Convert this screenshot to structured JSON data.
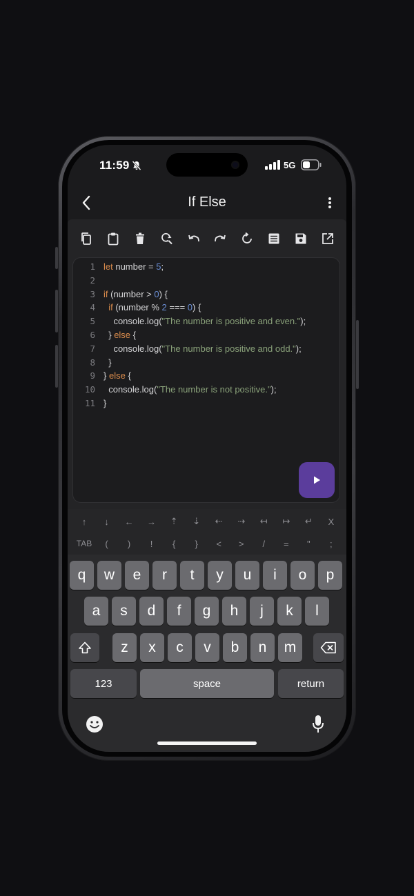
{
  "status_bar": {
    "time": "11:59",
    "network": "5G"
  },
  "header": {
    "title": "If Else"
  },
  "toolbar": {
    "icons": [
      "copy-icon",
      "paste-icon",
      "trash-icon",
      "find-replace-icon",
      "undo-icon",
      "redo-icon",
      "reload-icon",
      "format-icon",
      "save-icon",
      "share-icon"
    ]
  },
  "editor": {
    "lines": [
      {
        "n": "1",
        "tokens": [
          {
            "t": "let",
            "c": "kw"
          },
          {
            "t": " number = ",
            "c": "pl"
          },
          {
            "t": "5",
            "c": "num"
          },
          {
            "t": ";",
            "c": "pl"
          }
        ]
      },
      {
        "n": "2",
        "tokens": []
      },
      {
        "n": "3",
        "tokens": [
          {
            "t": "if",
            "c": "kw"
          },
          {
            "t": " (number > ",
            "c": "pl"
          },
          {
            "t": "0",
            "c": "num"
          },
          {
            "t": ") {",
            "c": "pl"
          }
        ]
      },
      {
        "n": "4",
        "tokens": [
          {
            "t": "  ",
            "c": "pl"
          },
          {
            "t": "if",
            "c": "kw"
          },
          {
            "t": " (number % ",
            "c": "pl"
          },
          {
            "t": "2",
            "c": "num"
          },
          {
            "t": " === ",
            "c": "pl"
          },
          {
            "t": "0",
            "c": "num"
          },
          {
            "t": ") {",
            "c": "pl"
          }
        ]
      },
      {
        "n": "5",
        "tokens": [
          {
            "t": "    console.log(",
            "c": "pl"
          },
          {
            "t": "\"The number is positive and even.\"",
            "c": "str"
          },
          {
            "t": ");",
            "c": "pl"
          }
        ]
      },
      {
        "n": "6",
        "tokens": [
          {
            "t": "  } ",
            "c": "pl"
          },
          {
            "t": "else",
            "c": "kw"
          },
          {
            "t": " {",
            "c": "pl"
          }
        ]
      },
      {
        "n": "7",
        "tokens": [
          {
            "t": "    console.log(",
            "c": "pl"
          },
          {
            "t": "\"The number is positive and odd.\"",
            "c": "str"
          },
          {
            "t": ");",
            "c": "pl"
          }
        ]
      },
      {
        "n": "8",
        "tokens": [
          {
            "t": "  }",
            "c": "pl"
          }
        ]
      },
      {
        "n": "9",
        "tokens": [
          {
            "t": "} ",
            "c": "pl"
          },
          {
            "t": "else",
            "c": "kw"
          },
          {
            "t": " {",
            "c": "pl"
          }
        ]
      },
      {
        "n": "10",
        "tokens": [
          {
            "t": "  console.log(",
            "c": "pl"
          },
          {
            "t": "\"The number is not positive.\"",
            "c": "str"
          },
          {
            "t": ");",
            "c": "pl"
          }
        ]
      },
      {
        "n": "11",
        "tokens": [
          {
            "t": "}",
            "c": "pl"
          }
        ]
      }
    ]
  },
  "accessory": {
    "row1": [
      "↑",
      "↓",
      "←",
      "→",
      "⇡",
      "⇣",
      "⇠",
      "⇢",
      "↤",
      "↦",
      "↵",
      "X"
    ],
    "row2": [
      "TAB",
      "(",
      ")",
      "!",
      "{",
      "}",
      "<",
      ">",
      "/",
      "=",
      "\"",
      ";"
    ]
  },
  "keyboard": {
    "row1": [
      "q",
      "w",
      "e",
      "r",
      "t",
      "y",
      "u",
      "i",
      "o",
      "p"
    ],
    "row2": [
      "a",
      "s",
      "d",
      "f",
      "g",
      "h",
      "j",
      "k",
      "l"
    ],
    "row3": [
      "z",
      "x",
      "c",
      "v",
      "b",
      "n",
      "m"
    ],
    "numbers_label": "123",
    "space_label": "space",
    "return_label": "return"
  },
  "colors": {
    "accent": "#5b3d9c",
    "keyword": "#d98b4c",
    "number": "#6b8fd6",
    "string": "#8aa27a"
  }
}
